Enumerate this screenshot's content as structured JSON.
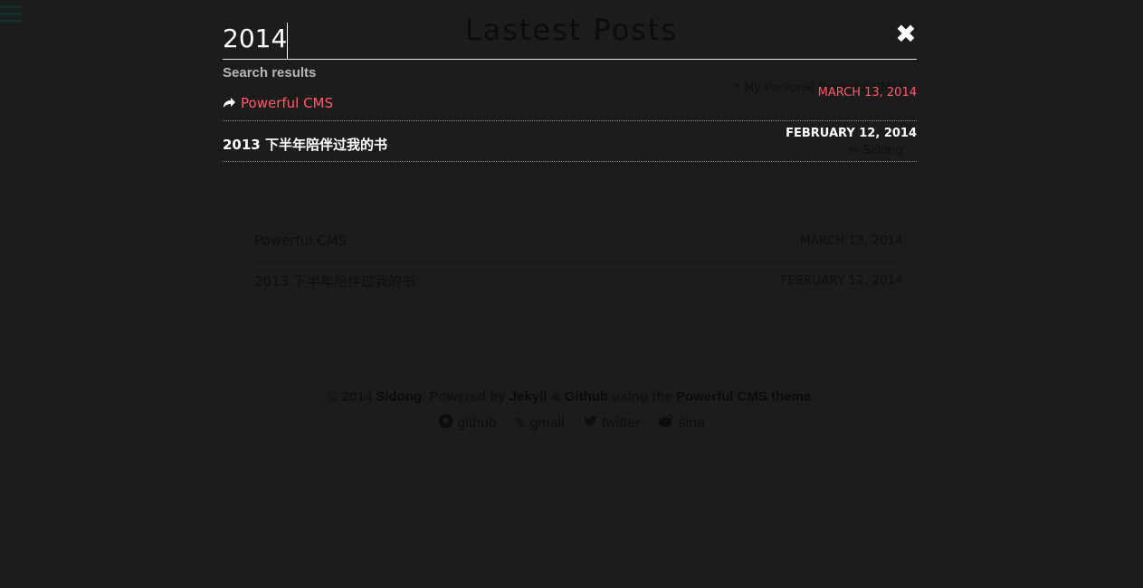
{
  "background_page": {
    "title": "Lastest Posts",
    "side_info": [
      {
        "icon": "quote-icon",
        "glyph": "❝",
        "text": "My Personal Powerful CMS!"
      },
      {
        "icon": "tag-icon",
        "glyph": "",
        "text": ""
      },
      {
        "icon": "clock-icon",
        "glyph": "",
        "text": ""
      },
      {
        "icon": "envelope-icon",
        "glyph": "✉",
        "text": "Sidong"
      }
    ],
    "posts": [
      {
        "title": "Powerful CMS",
        "date": "MARCH 13, 2014"
      },
      {
        "title": "2013 下半年陪伴过我的书",
        "date": "FEBRUARY 12, 2014"
      }
    ],
    "footer": {
      "copyright": "© 2014",
      "author": "Sidong",
      "powered_by": ". Powered by",
      "jekyll": "Jekyll",
      "amp": "&",
      "github": "Github",
      "using_the": "using the",
      "theme": "Powerful CMS theme",
      "period": "."
    },
    "social": [
      {
        "icon": "github-icon",
        "label": "github"
      },
      {
        "icon": "pencil-icon",
        "label": "gmail"
      },
      {
        "icon": "twitter-icon",
        "label": "twitter"
      },
      {
        "icon": "weibo-icon",
        "label": "sina"
      }
    ]
  },
  "search": {
    "query": "2014",
    "close_icon": "close-icon",
    "results_heading": "Search results",
    "results": [
      {
        "title": "Powerful CMS",
        "date": "MARCH 13, 2014",
        "active": true
      },
      {
        "title": "2013 下半年陪伴过我的书",
        "date": "FEBRUARY 12, 2014",
        "active": false
      }
    ]
  },
  "colors": {
    "background": "#1c1c1c",
    "accent": "#ff5a6a",
    "text": "#ffffff",
    "muted": "#b5b5b5"
  }
}
